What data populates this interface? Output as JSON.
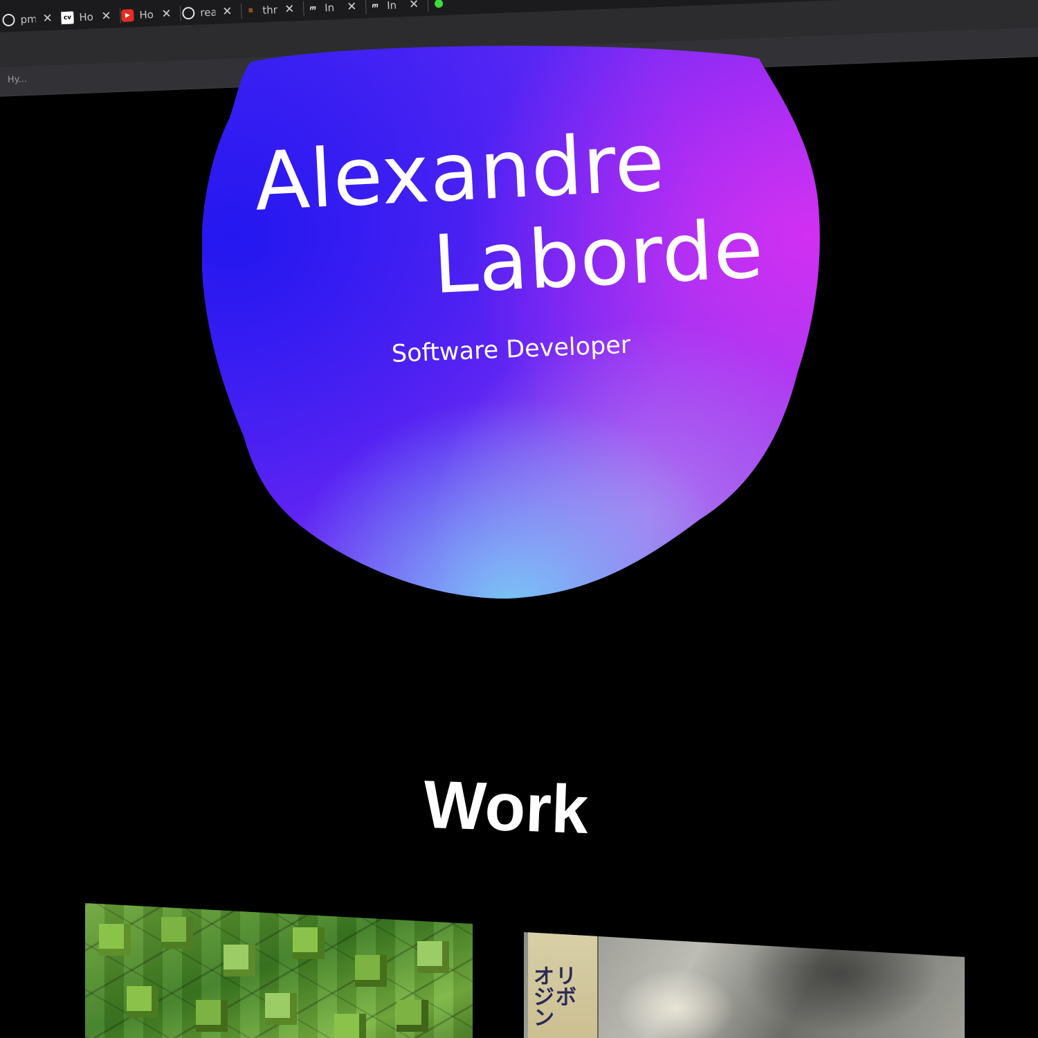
{
  "browser": {
    "tabs": [
      {
        "favicon": "github-icon",
        "title": "pm"
      },
      {
        "favicon": "cv-icon",
        "title": "Ho"
      },
      {
        "favicon": "youtube-icon",
        "title": "Ho"
      },
      {
        "favicon": "github-icon",
        "title": "rea"
      },
      {
        "favicon": "stackoverflow-icon",
        "title": "thr"
      },
      {
        "favicon": "m-logo-icon",
        "title": "In"
      },
      {
        "favicon": "m-logo-icon",
        "title": "In"
      },
      {
        "favicon": "green-dot-icon",
        "title": ""
      }
    ],
    "close_glyph": "✕",
    "bookmark_label": "Hy..."
  },
  "hero": {
    "first_name": "Alexandre",
    "last_name": "Laborde",
    "tagline": "Software Developer",
    "blob_colors": [
      "#2c1cf5",
      "#7a24f7",
      "#c530f3",
      "#6ab7f7"
    ]
  },
  "work": {
    "title": "Work",
    "projects": [
      {
        "thumbnail": "green-cubes-image"
      },
      {
        "thumbnail": "album-cover-image",
        "cover_text": "オリジボン"
      }
    ]
  }
}
